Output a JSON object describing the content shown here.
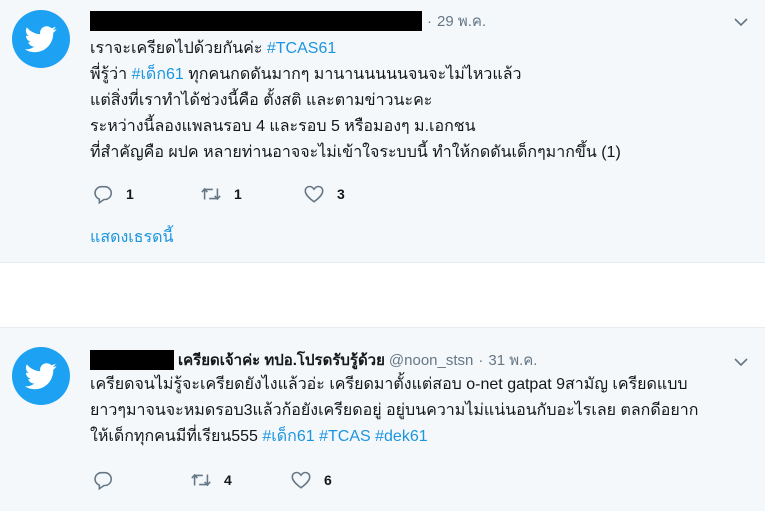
{
  "tweets": [
    {
      "time": "29 พ.ค.",
      "lines": [
        [
          {
            "t": "เราจะเครียดไปด้วยกันค่ะ "
          },
          {
            "t": "#TCAS61",
            "tag": true
          }
        ],
        [
          {
            "t": "พี่รู้ว่า "
          },
          {
            "t": "#เด็ก61",
            "tag": true
          },
          {
            "t": " ทุกคนกดดันมากๆ มานานนนนนจนจะไม่ไหวแล้ว"
          }
        ],
        [
          {
            "t": "แต่สิ่งที่เราทำได้ช่วงนี้คือ ตั้งสติ และตามข่าวนะคะ"
          }
        ],
        [
          {
            "t": "ระหว่างนี้ลองแพลนรอบ 4 และรอบ 5 หรือมองๆ ม.เอกชน"
          }
        ],
        [
          {
            "t": "ที่สำคัญคือ ผปค หลายท่านอาจจะไม่เข้าใจระบบนี้ ทำให้กดดันเด็กๆมากขึ้น (1)"
          }
        ]
      ],
      "replies": "1",
      "retweets": "1",
      "likes": "3",
      "show_thread": "แสดงเธรดนี้"
    },
    {
      "display_name": "เครียดเจ้าค่ะ ทปอ.โปรดรับรู้ด้วย",
      "handle": "@noon_stsn",
      "time": "31 พ.ค.",
      "lines": [
        [
          {
            "t": "เครียดจนไม่รู้จะเครียดยังไงแล้วอ่ะ เครียดมาตั้งแต่สอบ o-net gatpat 9สามัญ เครียดแบบ"
          }
        ],
        [
          {
            "t": "ยาวๆมาจนจะหมดรอบ3แล้วก้อยังเครียดอยู่ อยู่บนความไม่แน่นอนกับอะไรเลย ตลกดีอยาก"
          }
        ],
        [
          {
            "t": "ให้เด็กทุกคนมีที่เรียน555 "
          },
          {
            "t": "#เด็ก61",
            "tag": true
          },
          {
            "t": " "
          },
          {
            "t": "#TCAS",
            "tag": true
          },
          {
            "t": " "
          },
          {
            "t": "#dek61",
            "tag": true
          }
        ]
      ],
      "replies": "",
      "retweets": "4",
      "likes": "6"
    }
  ],
  "icons": {
    "avatar": "twitter-bird-icon",
    "caret": "chevron-down-icon",
    "reply": "reply-icon",
    "retweet": "retweet-icon",
    "like": "heart-icon"
  },
  "colors": {
    "twitter_blue": "#1da1f2",
    "hashtag": "#1b95e0",
    "secondary_text": "#657786",
    "tweet_background": "#f5f8fa"
  }
}
